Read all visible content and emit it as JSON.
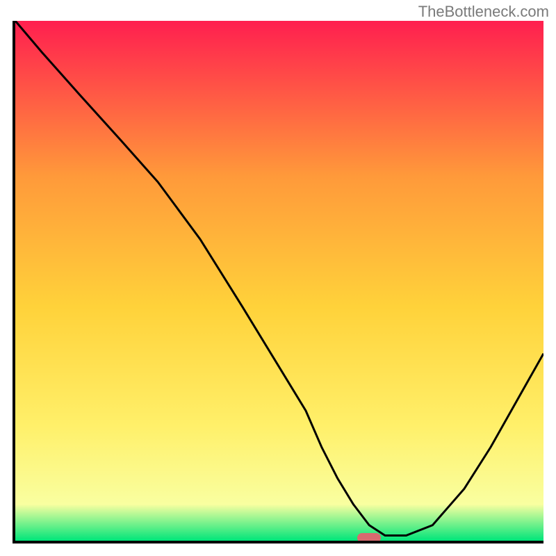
{
  "watermark": "TheBottleneck.com",
  "chart_data": {
    "type": "line",
    "title": "",
    "xlabel": "",
    "ylabel": "",
    "xlim": [
      0,
      100
    ],
    "ylim": [
      0,
      100
    ],
    "gradient_colors": {
      "top": "#ff1f4f",
      "upper_mid": "#ff9a3a",
      "mid": "#ffd23a",
      "lower_mid": "#fff06a",
      "near_bottom": "#f9ffa0",
      "bottom": "#00e57a"
    },
    "series": [
      {
        "name": "bottleneck-curve",
        "x": [
          0,
          5,
          12,
          20,
          27,
          35,
          43,
          49,
          55,
          58,
          61,
          64,
          67,
          70,
          74,
          79,
          85,
          90,
          95,
          100
        ],
        "y": [
          100,
          94,
          86,
          77,
          69,
          58,
          45,
          35,
          25,
          18,
          12,
          7,
          3,
          1,
          1,
          3,
          10,
          18,
          27,
          36
        ]
      }
    ],
    "marker": {
      "x": 67,
      "y": 0.5,
      "color": "#d96a6f"
    }
  }
}
